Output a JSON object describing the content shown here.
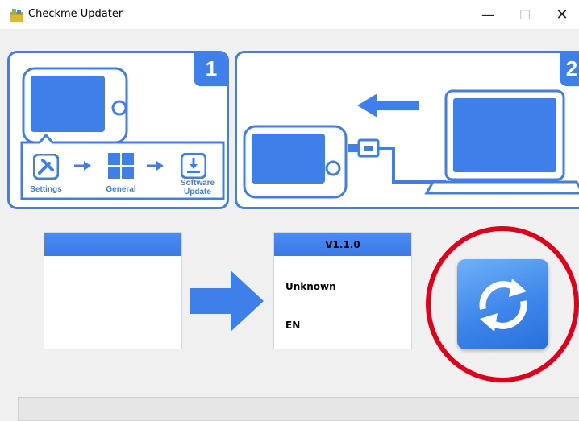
{
  "window": {
    "title": "Checkme Updater",
    "minimize_glyph": "—",
    "maximize_glyph": "☐",
    "close_glyph": "✕"
  },
  "instructions": {
    "step1": {
      "number": "1",
      "path": [
        {
          "label": "Settings",
          "icon": "tools-icon"
        },
        {
          "label": "General",
          "icon": "windows-grid-icon"
        },
        {
          "label": "Software Update",
          "icon": "download-icon"
        }
      ]
    },
    "step2": {
      "number": "2"
    }
  },
  "current_panel": {
    "header": ""
  },
  "new_panel": {
    "header": "V1.1.0",
    "line1": "Unknown",
    "line2": "EN"
  },
  "colors": {
    "accent_blue": "#3f7fe9",
    "highlight_red": "#e0001a"
  },
  "icons": {
    "refresh": "refresh-icon",
    "arrow": "arrow-right-icon"
  }
}
